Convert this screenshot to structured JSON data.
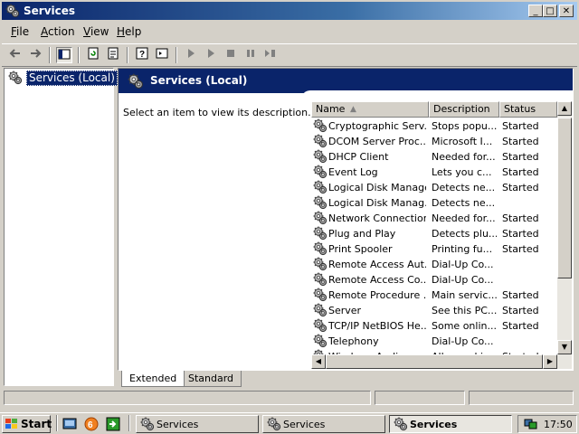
{
  "window": {
    "title": "Services"
  },
  "menu": [
    "File",
    "Action",
    "View",
    "Help"
  ],
  "tree": {
    "selected": "Services (Local)"
  },
  "right_header": "Services (Local)",
  "description_prompt": "Select an item to view its description.",
  "columns": [
    "Name",
    "Description",
    "Status"
  ],
  "services": [
    {
      "name": "Cryptographic Serv...",
      "description": "Stops popu...",
      "status": "Started"
    },
    {
      "name": "DCOM Server Proc...",
      "description": "Microsoft I...",
      "status": "Started"
    },
    {
      "name": "DHCP Client",
      "description": "Needed for...",
      "status": "Started"
    },
    {
      "name": "Event Log",
      "description": "Lets you c...",
      "status": "Started"
    },
    {
      "name": "Logical Disk Manager",
      "description": "Detects ne...",
      "status": "Started"
    },
    {
      "name": "Logical Disk Manag...",
      "description": "Detects ne...",
      "status": ""
    },
    {
      "name": "Network Connections",
      "description": "Needed for...",
      "status": "Started"
    },
    {
      "name": "Plug and Play",
      "description": "Detects plu...",
      "status": "Started"
    },
    {
      "name": "Print Spooler",
      "description": "Printing fu...",
      "status": "Started"
    },
    {
      "name": "Remote Access Aut...",
      "description": "Dial-Up Co...",
      "status": ""
    },
    {
      "name": "Remote Access Co...",
      "description": "Dial-Up Co...",
      "status": ""
    },
    {
      "name": "Remote Procedure ...",
      "description": "Main servic...",
      "status": "Started"
    },
    {
      "name": "Server",
      "description": "See this PC...",
      "status": "Started"
    },
    {
      "name": "TCP/IP NetBIOS He...",
      "description": "Some onlin...",
      "status": "Started"
    },
    {
      "name": "Telephony",
      "description": "Dial-Up Co...",
      "status": ""
    },
    {
      "name": "Windows Audio",
      "description": "All sound in...",
      "status": "Started"
    }
  ],
  "tabs": [
    "Extended",
    "Standard"
  ],
  "taskbar": {
    "start": "Start",
    "tasks": [
      "Services",
      "Services",
      "Services"
    ],
    "active_task": 2,
    "clock": "17:50"
  },
  "icons": {
    "service": "gear-icon",
    "back": "back-arrow-icon",
    "forward": "forward-arrow-icon"
  },
  "colors": {
    "title_active": "#0a246a",
    "selection": "#0a246a",
    "face": "#d4d0c8",
    "desktop": "#3a6ea5"
  }
}
